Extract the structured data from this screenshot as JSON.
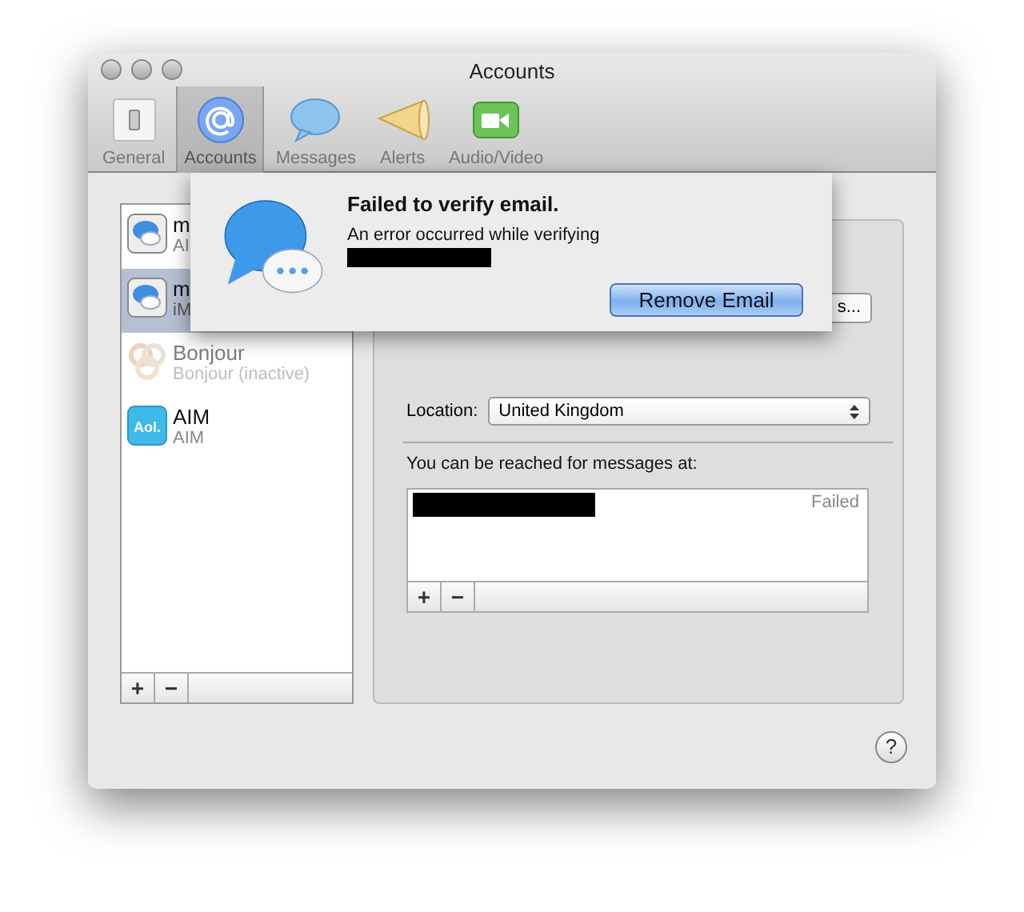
{
  "window": {
    "title": "Accounts"
  },
  "tabs": [
    {
      "label": "General",
      "kind": "general",
      "selected": false
    },
    {
      "label": "Accounts",
      "kind": "accounts",
      "selected": true
    },
    {
      "label": "Messages",
      "kind": "messages",
      "selected": false
    },
    {
      "label": "Alerts",
      "kind": "alerts",
      "selected": false
    },
    {
      "label": "Audio/Video",
      "kind": "video",
      "selected": false
    }
  ],
  "accounts": [
    {
      "name": "m",
      "subtitle": "AI",
      "kind": "bubble",
      "selected": false,
      "active": true
    },
    {
      "name": "m",
      "subtitle": "iM",
      "kind": "bubble",
      "selected": true,
      "active": true
    },
    {
      "name": "Bonjour",
      "subtitle": "Bonjour (inactive)",
      "kind": "bonjour",
      "selected": false,
      "active": false
    },
    {
      "name": "AIM",
      "subtitle": "AIM",
      "kind": "aim",
      "icon_text": "Aol.",
      "selected": false,
      "active": true
    }
  ],
  "account_buttons": [
    "+",
    "−"
  ],
  "details_button": "s...",
  "location": {
    "label": "Location:",
    "value": "United Kingdom"
  },
  "reachable": {
    "label": "You can be reached for messages at:",
    "rows": [
      {
        "status": "Failed"
      }
    ],
    "buttons": [
      "+",
      "−"
    ]
  },
  "help_button": "?",
  "sheet": {
    "title": "Failed to verify email.",
    "message": "An error occurred while verifying",
    "button": "Remove Email"
  }
}
